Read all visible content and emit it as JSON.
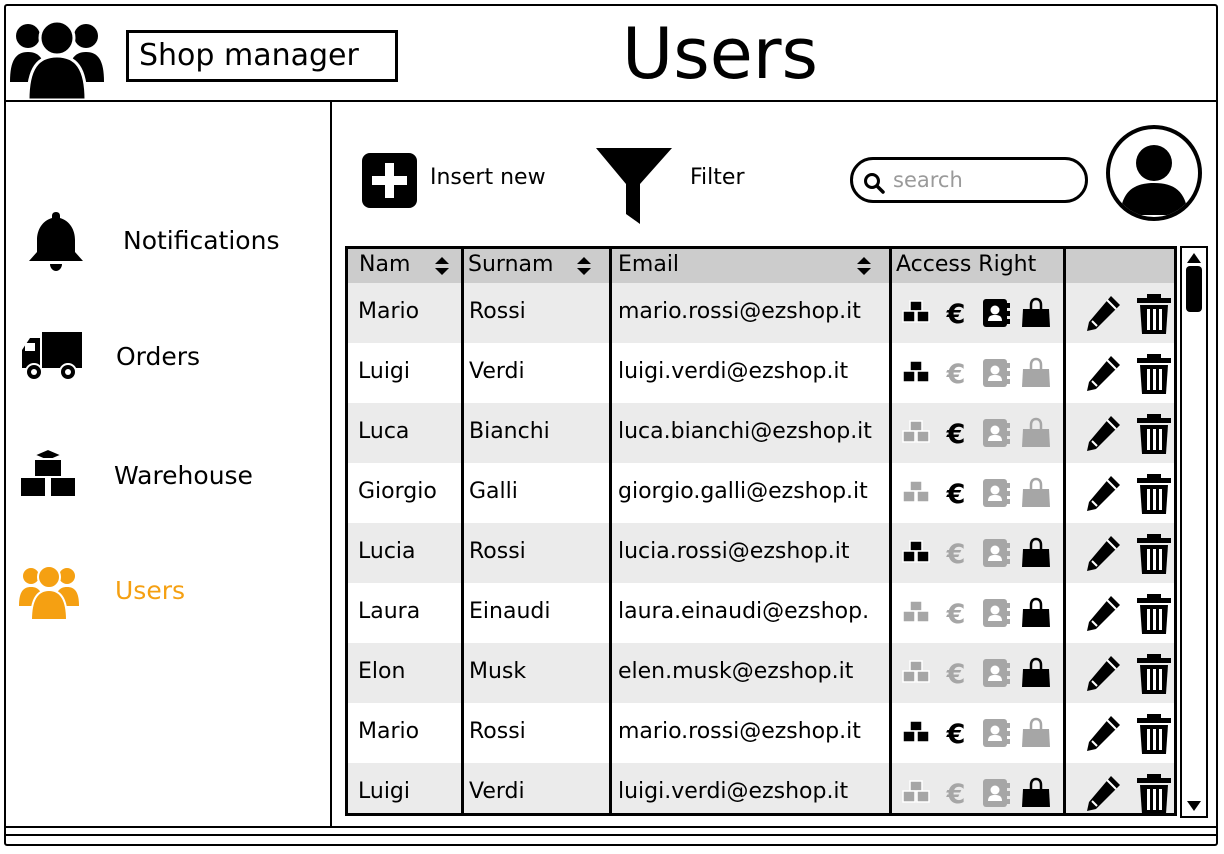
{
  "header": {
    "app_title": "Shop manager",
    "page_title": "Users"
  },
  "sidebar": {
    "items": [
      {
        "label": "Notifications",
        "icon": "bell-icon"
      },
      {
        "label": "Orders",
        "icon": "truck-icon"
      },
      {
        "label": "Warehouse",
        "icon": "boxes-icon"
      },
      {
        "label": "Users",
        "icon": "users-icon",
        "active": true
      }
    ]
  },
  "toolbar": {
    "insert_label": "Insert new",
    "filter_label": "Filter",
    "search_placeholder": "search"
  },
  "table": {
    "columns": [
      "Nam",
      "Surnam",
      "Email",
      "Access Right"
    ],
    "rows": [
      {
        "name": "Mario",
        "surname": "Rossi",
        "email": "mario.rossi@ezshop.it",
        "access": [
          true,
          true,
          true,
          true
        ]
      },
      {
        "name": "Luigi",
        "surname": "Verdi",
        "email": "luigi.verdi@ezshop.it",
        "access": [
          true,
          false,
          false,
          false
        ]
      },
      {
        "name": "Luca",
        "surname": "Bianchi",
        "email": "luca.bianchi@ezshop.it",
        "access": [
          false,
          true,
          false,
          false
        ]
      },
      {
        "name": "Giorgio",
        "surname": "Galli",
        "email": "giorgio.galli@ezshop.it",
        "access": [
          false,
          true,
          false,
          false
        ]
      },
      {
        "name": "Lucia",
        "surname": "Rossi",
        "email": "lucia.rossi@ezshop.it",
        "access": [
          true,
          false,
          false,
          true
        ]
      },
      {
        "name": "Laura",
        "surname": "Einaudi",
        "email": "laura.einaudi@ezshop.",
        "access": [
          false,
          false,
          false,
          true
        ]
      },
      {
        "name": "Elon",
        "surname": "Musk",
        "email": "elen.musk@ezshop.it",
        "access": [
          false,
          false,
          false,
          true
        ]
      },
      {
        "name": "Mario",
        "surname": "Rossi",
        "email": "mario.rossi@ezshop.it",
        "access": [
          true,
          true,
          false,
          false
        ]
      },
      {
        "name": "Luigi",
        "surname": "Verdi",
        "email": "luigi.verdi@ezshop.it",
        "access": [
          false,
          false,
          false,
          true
        ]
      }
    ]
  },
  "colors": {
    "accent": "#f5a012",
    "disabled_icon": "#a6a6a6",
    "header_bg": "#cccccc",
    "row_alt": "#ebebeb"
  }
}
